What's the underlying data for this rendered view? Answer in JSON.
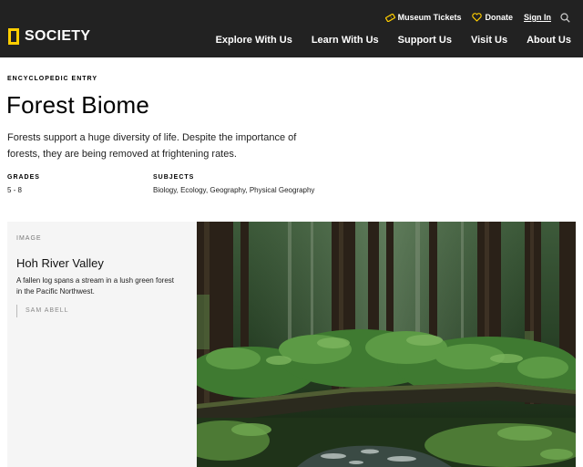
{
  "header": {
    "utility": {
      "tickets_label": "Museum Tickets",
      "donate_label": "Donate",
      "signin_label": "Sign In"
    },
    "logo_text": "SOCIETY",
    "nav": [
      {
        "label": "Explore With Us"
      },
      {
        "label": "Learn With Us"
      },
      {
        "label": "Support Us"
      },
      {
        "label": "Visit Us"
      },
      {
        "label": "About Us"
      }
    ]
  },
  "entry": {
    "eyebrow": "ENCYCLOPEDIC ENTRY",
    "title": "Forest Biome",
    "description": "Forests support a huge diversity of life. Despite the importance of forests, they are being removed at frightening rates.",
    "grades_label": "GRADES",
    "grades_value": "5 - 8",
    "subjects_label": "SUBJECTS",
    "subjects_value": "Biology, Ecology, Geography, Physical Geography"
  },
  "image": {
    "eyebrow": "IMAGE",
    "title": "Hoh River Valley",
    "caption": "A fallen log spans a stream in a lush green forest in the Pacific Northwest.",
    "credit": "SAM ABELL",
    "photo_icon": "forest-photo"
  },
  "colors": {
    "header_bg": "#222222",
    "brand_yellow": "#ffce00",
    "panel_bg": "#f5f5f5"
  }
}
